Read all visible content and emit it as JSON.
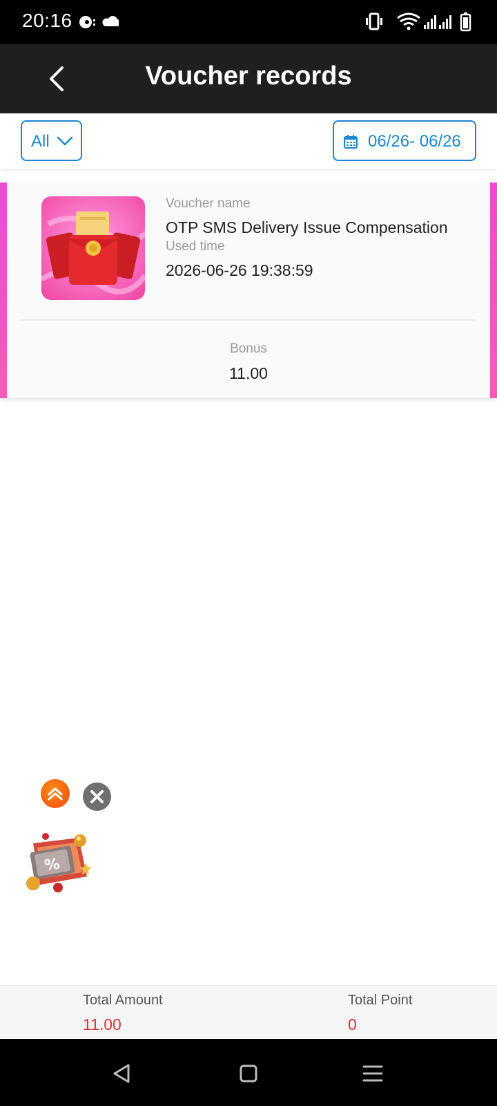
{
  "status_bar": {
    "time": "20:16"
  },
  "header": {
    "title": "Voucher records",
    "back_icon": "chevron-left-icon"
  },
  "filters": {
    "type_selected": "All",
    "date_range": "06/26- 06/26",
    "accent_color": "#1a86d0"
  },
  "records": [
    {
      "name_label": "Voucher name",
      "name": "OTP SMS Delivery Issue Compensation",
      "time_label": "Used time",
      "time": "2026-06-26 19:38:59",
      "bonus_label": "Bonus",
      "bonus": "11.00",
      "thumbnail_icon": "red-envelope-icon",
      "accent_color": "#f04ad6"
    }
  ],
  "floating": {
    "scroll_top_icon": "double-chevron-up-icon",
    "close_icon": "close-icon",
    "promo_icon": "discount-coupon-icon"
  },
  "totals": {
    "amount_label": "Total Amount",
    "amount_value": "11.00",
    "point_label": "Total Point",
    "point_value": "0",
    "value_color": "#e53030"
  },
  "nav_bar": {
    "back_icon": "triangle-back-icon",
    "home_icon": "square-home-icon",
    "menu_icon": "menu-lines-icon"
  }
}
